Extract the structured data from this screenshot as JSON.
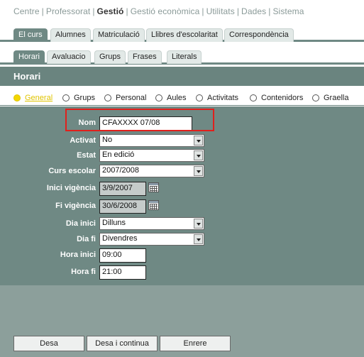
{
  "topnav": {
    "items": [
      "Centre",
      "Professorat",
      "Gestió",
      "Gestió econòmica",
      "Utilitats",
      "Dades",
      "Sistema"
    ],
    "active": "Gestió",
    "separator": "|"
  },
  "tabs_primary": [
    "El curs",
    "Alumnes",
    "Matriculació",
    "Llibres d'escolaritat",
    "Correspondència"
  ],
  "tabs_secondary": [
    "Horari",
    "Avaluacio",
    "Grups",
    "Frases",
    "Literals"
  ],
  "page_title": "Horari",
  "radio_options": [
    "General",
    "Grups",
    "Personal",
    "Aules",
    "Activitats",
    "Contenidors",
    "Graella"
  ],
  "selected_radio": "General",
  "form": {
    "nom": {
      "label": "Nom",
      "value": "CFAXXXX 07/08"
    },
    "activat": {
      "label": "Activat",
      "value": "No"
    },
    "estat": {
      "label": "Estat",
      "value": "En edició"
    },
    "curs_escolar": {
      "label": "Curs escolar",
      "value": "2007/2008"
    },
    "inici_vigencia": {
      "label": "Inici vigència",
      "value": "3/9/2007"
    },
    "fi_vigencia": {
      "label": "Fi vigència",
      "value": "30/6/2008"
    },
    "dia_inici": {
      "label": "Dia inici",
      "value": "Dilluns"
    },
    "dia_fi": {
      "label": "Dia fi",
      "value": "Divendres"
    },
    "hora_inici": {
      "label": "Hora inici",
      "value": "09:00"
    },
    "hora_fi": {
      "label": "Hora fi",
      "value": "21:00"
    }
  },
  "buttons": {
    "save": "Desa",
    "save_continue": "Desa i continua",
    "back": "Enrere"
  },
  "colors": {
    "panel": "#6f8984",
    "header": "#6a847f",
    "bottom": "#8c9f9b",
    "highlight": "#e0201c",
    "selected_radio": "#f3d600"
  }
}
